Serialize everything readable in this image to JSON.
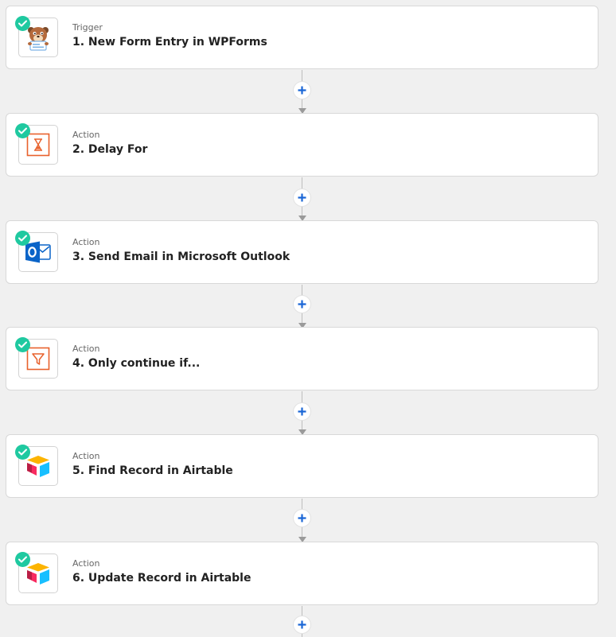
{
  "steps": [
    {
      "kind": "Trigger",
      "title": "1. New Form Entry in WPForms",
      "icon": "wpforms-icon"
    },
    {
      "kind": "Action",
      "title": "2. Delay For",
      "icon": "hourglass-icon"
    },
    {
      "kind": "Action",
      "title": "3. Send Email in Microsoft Outlook",
      "icon": "outlook-icon"
    },
    {
      "kind": "Action",
      "title": "4. Only continue if...",
      "icon": "filter-icon"
    },
    {
      "kind": "Action",
      "title": "5. Find Record in Airtable",
      "icon": "airtable-icon"
    },
    {
      "kind": "Action",
      "title": "6. Update Record in Airtable",
      "icon": "airtable-icon"
    }
  ],
  "status_icon": "checkmark-icon",
  "add_icon": "plus-icon",
  "colors": {
    "check": "#1fc9a0",
    "plus": "#1a66d6",
    "delay_filter_accent": "#e8612c",
    "outlook": "#0a64c8"
  }
}
